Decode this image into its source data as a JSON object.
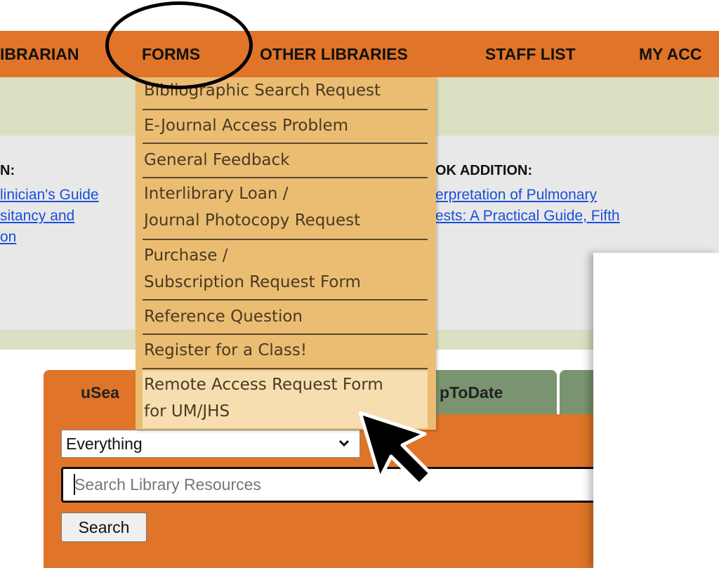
{
  "nav": {
    "items": [
      "IBRARIAN",
      "FORMS",
      "OTHER LIBRARIES",
      "STAFF LIST",
      "MY ACC"
    ]
  },
  "featured": {
    "left_label": "N:",
    "left_link_lines": [
      "linician's Guide",
      "sitancy and",
      "on"
    ],
    "right_label": "OK ADDITION:",
    "right_link_lines": [
      "erpretation of Pulmonary",
      "ests: A Practical Guide, Fifth"
    ]
  },
  "forms_menu": {
    "items": [
      "Bibliographic Search Request",
      "E-Journal Access Problem",
      "General Feedback",
      "Interlibrary Loan /",
      " Journal Photocopy Request",
      "Purchase /",
      " Subscription Request Form",
      "Reference Question",
      "Register for a Class!",
      "Remote Access Request Form",
      "for UM/JHS"
    ]
  },
  "search": {
    "tab_active": "uSea",
    "tab_second": "pToDate",
    "scope_value": "Everything",
    "placeholder": "Search Library Resources",
    "button_label": "Search"
  },
  "colors": {
    "nav_bg": "#e07428",
    "menu_bg": "#eabd72",
    "menu_highlight": "#f6deb0",
    "link": "#1a4fd6",
    "tab_inactive": "#7a9470"
  },
  "icons": [
    "chevron-down-icon",
    "mouse-cursor-icon",
    "annotation-circle"
  ]
}
